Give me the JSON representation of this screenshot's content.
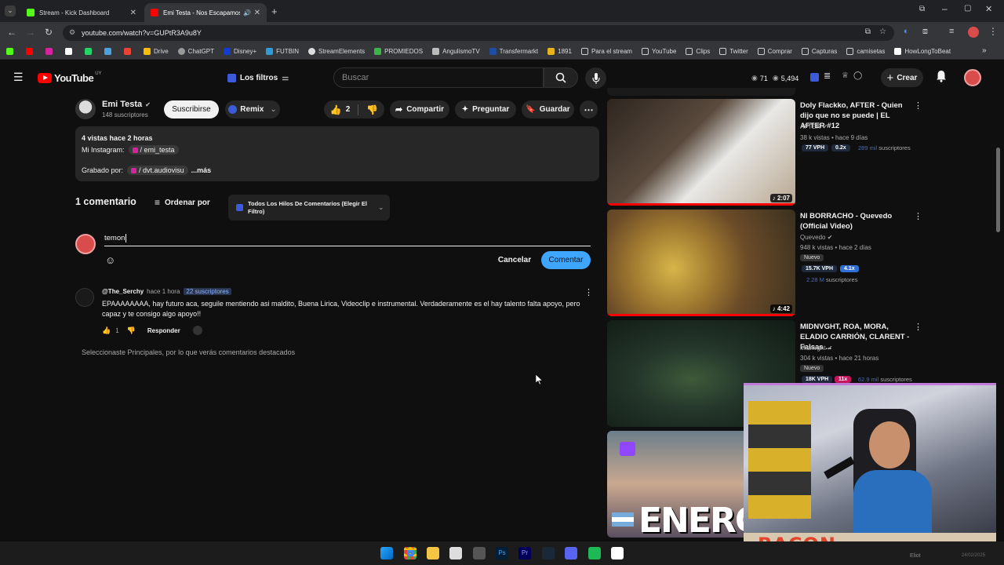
{
  "browser": {
    "tabs": [
      {
        "title": "Stream - Kick Dashboard"
      },
      {
        "title": "Emi Testa - Nos Escapamos"
      }
    ],
    "url": "youtube.com/watch?v=GUPtR3A9u8Y",
    "bookmarks": [
      "Drive",
      "ChatGPT",
      "Disney+",
      "FUTBIN",
      "StreamElements",
      "PROMIEDOS",
      "AngulismoTV",
      "Transfermarkt",
      "1891",
      "Para el stream",
      "YouTube",
      "Clips",
      "Twitter",
      "Comprar",
      "Capturas",
      "camisetas",
      "HowLongToBeat"
    ]
  },
  "header": {
    "logo": "YouTube",
    "logo_region": "UY",
    "filters": "Los filtros",
    "search_placeholder": "Buscar",
    "stat1": "71",
    "stat2": "5,494",
    "create": "Crear"
  },
  "channel": {
    "name": "Emi Testa",
    "subs": "148 suscriptores",
    "subscribe": "Suscribirse",
    "remix": "Remix",
    "likes": "2",
    "share": "Compartir",
    "ask": "Preguntar",
    "save": "Guardar"
  },
  "description": {
    "stats": "4 vistas  hace 2 horas",
    "line2_prefix": "Mi Instagram:",
    "line2_link": "/ emi_testa",
    "line3_prefix": "Grabado por:",
    "line3_link": "/ dvt.audiovisu",
    "more": "...más"
  },
  "comments": {
    "count": "1 comentario",
    "sort": "Ordenar por",
    "filter": "Todos Los Hilos De Comentarios (Elegir El Filtro)",
    "input_value": "temon",
    "cancel": "Cancelar",
    "submit": "Comentar",
    "items": [
      {
        "author": "@The_Serchy",
        "time": "hace 1 hora",
        "subs_badge": "22 suscriptores",
        "text": "EPAAAAAAAA, hay futuro aca, seguile mentiendo asi maldito, Buena Lirica, Videoclip e instrumental. Verdaderamente es el hay talento falta apoyo, pero capaz y te consigo algo apoyo!!",
        "likes": "1",
        "reply": "Responder"
      }
    ],
    "note": "Seleccionaste Principales, por lo que verás comentarios destacados"
  },
  "sidebar": [
    {
      "title": "Doly Flackko, AFTER - Quien dijo que no se puede | EL AFTER #12",
      "channel": "AFTER",
      "meta": "38 k vistas • hace 9 días",
      "duration": "2:07",
      "vph": "77 VPH",
      "mult": "0.2x",
      "subs_num": "289 mil",
      "subs_word": "suscriptores"
    },
    {
      "title": "NI BORRACHO - Quevedo (Official Video)",
      "channel": "Quevedo",
      "meta": "948 k vistas • hace 2 días",
      "tag": "Nuevo",
      "duration": "4:42",
      "vph": "15.7K VPH",
      "mult": "4.1x",
      "subs_num": "2.28 M",
      "subs_word": "suscriptores"
    },
    {
      "title": "MIDNVGHT, ROA, MORA, ELADIO CARRIÓN, CLARENT - Falsas ...",
      "channel": "Midnvght",
      "meta": "304 k vistas • hace 21 horas",
      "tag": "Nuevo",
      "vph": "18K VPH",
      "mult": "11x",
      "subs_num": "62.9 mil",
      "subs_word": "suscriptores"
    },
    {
      "thumb_text": "ENERO"
    }
  ],
  "overlay": {
    "text": "BACON"
  },
  "taskbar": {
    "user": "Eliot",
    "date": "24/02/2025"
  }
}
